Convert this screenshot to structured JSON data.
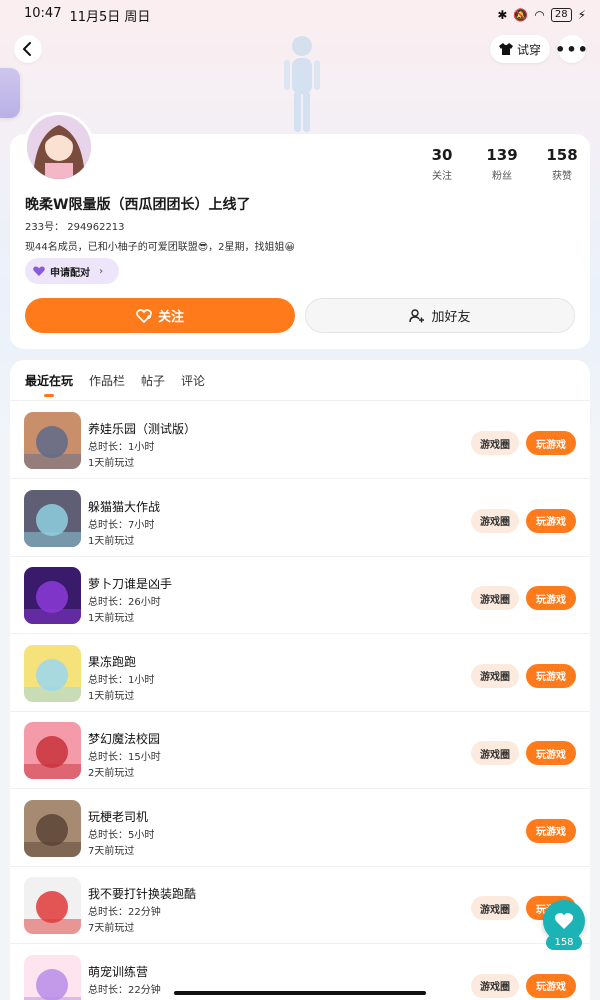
{
  "status": {
    "time": "10:47",
    "date": "11月5日 周日",
    "battery": "28"
  },
  "header": {
    "tryon_label": "试穿",
    "more_label": "•••"
  },
  "profile": {
    "stats": [
      {
        "num": "30",
        "label": "关注"
      },
      {
        "num": "139",
        "label": "粉丝"
      },
      {
        "num": "158",
        "label": "获赞"
      }
    ],
    "name": "晚柔W限量版（西瓜团团长）上线了",
    "uid": "233号： 294962213",
    "bio": "现44名成员，已和小柚子的可爱团联盟😎，2星期，找姐姐😀",
    "pair_label": "申请配对",
    "follow_label": "关注",
    "add_friend_label": "加好友"
  },
  "tabs": [
    "最近在玩",
    "作品栏",
    "帖子",
    "评论"
  ],
  "games": [
    {
      "name": "养娃乐园（测试版）",
      "duration": "总时长：1小时",
      "last": "1天前玩过",
      "circle": "游戏圈",
      "play": "玩游戏",
      "color1": "#c98e6a",
      "color2": "#5f6b8a"
    },
    {
      "name": "躲猫猫大作战",
      "duration": "总时长：7小时",
      "last": "1天前玩过",
      "circle": "游戏圈",
      "play": "玩游戏",
      "color1": "#5f5e74",
      "color2": "#8fd0e0"
    },
    {
      "name": "萝卜刀谁是凶手",
      "duration": "总时长：26小时",
      "last": "1天前玩过",
      "circle": "游戏圈",
      "play": "玩游戏",
      "color1": "#3a1b6b",
      "color2": "#8b3ad8"
    },
    {
      "name": "果冻跑跑",
      "duration": "总时长：1小时",
      "last": "1天前玩过",
      "circle": "游戏圈",
      "play": "玩游戏",
      "color1": "#f6e27a",
      "color2": "#9ad7f0"
    },
    {
      "name": "梦幻魔法校园",
      "duration": "总时长：15小时",
      "last": "2天前玩过",
      "circle": "游戏圈",
      "play": "玩游戏",
      "color1": "#f59aa8",
      "color2": "#c8323c"
    },
    {
      "name": "玩梗老司机",
      "duration": "总时长：5小时",
      "last": "7天前玩过",
      "circle": "",
      "play": "玩游戏",
      "color1": "#a68a72",
      "color2": "#5a4436"
    },
    {
      "name": "我不要打针换装跑酷",
      "duration": "总时长：22分钟",
      "last": "7天前玩过",
      "circle": "游戏圈",
      "play": "玩游戏",
      "color1": "#f1f1f1",
      "color2": "#e03a3a"
    },
    {
      "name": "萌宠训练营",
      "duration": "总时长：22分钟",
      "last": "",
      "circle": "游戏圈",
      "play": "玩游戏",
      "color1": "#fde4ef",
      "color2": "#b98de8"
    }
  ],
  "like": {
    "count": "158"
  }
}
